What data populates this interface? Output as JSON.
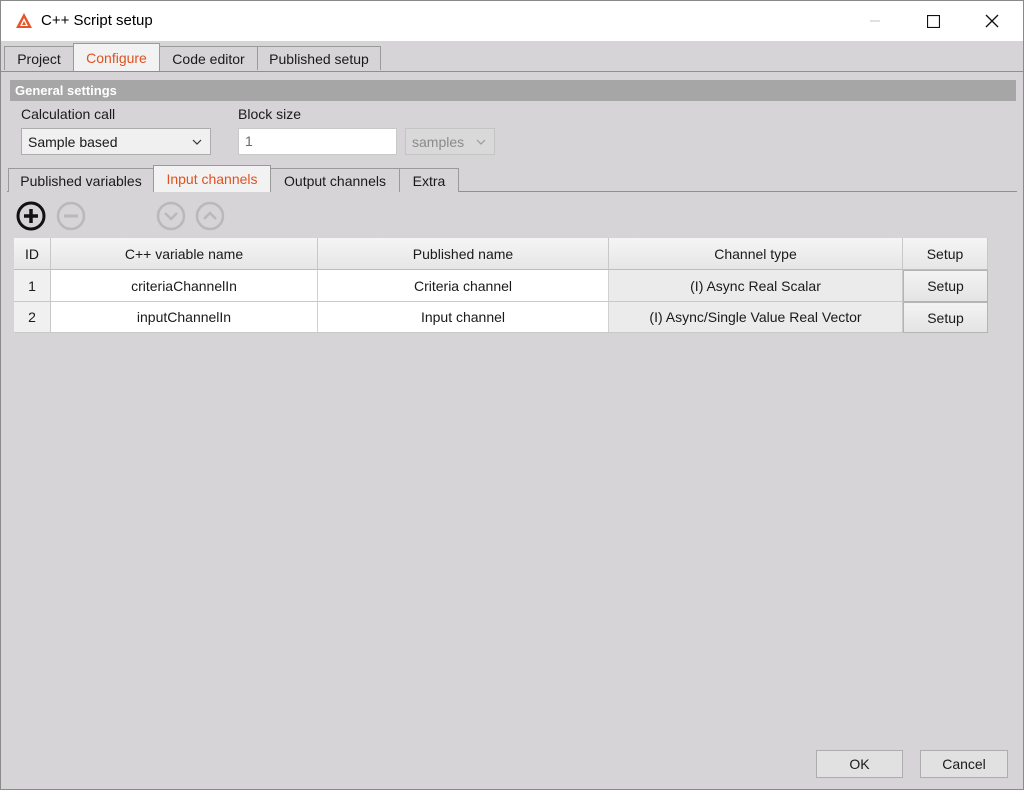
{
  "window": {
    "title": "C++ Script setup",
    "accent_color": "#e0521f"
  },
  "main_tabs": [
    {
      "label": "Project"
    },
    {
      "label": "Configure"
    },
    {
      "label": "Code editor"
    },
    {
      "label": "Published setup"
    }
  ],
  "general_settings": {
    "title": "General settings",
    "calc_label": "Calculation call",
    "calc_value": "Sample based",
    "block_label": "Block size",
    "block_value": "1",
    "block_unit": "samples"
  },
  "sub_tabs": [
    {
      "label": "Published variables"
    },
    {
      "label": "Input channels"
    },
    {
      "label": "Output channels"
    },
    {
      "label": "Extra"
    }
  ],
  "toolbar": {
    "icons": [
      "add-icon",
      "remove-icon",
      "move-down-icon",
      "move-up-icon"
    ]
  },
  "table": {
    "headers": [
      "ID",
      "C++ variable name",
      "Published name",
      "Channel type",
      "Setup"
    ],
    "rows": [
      {
        "id": "1",
        "var": "criteriaChannelIn",
        "pub": "Criteria channel",
        "type": "(I) Async Real Scalar",
        "setup": "Setup"
      },
      {
        "id": "2",
        "var": "inputChannelIn",
        "pub": "Input channel",
        "type": "(I) Async/Single Value Real Vector",
        "setup": "Setup"
      }
    ]
  },
  "footer": {
    "ok": "OK",
    "cancel": "Cancel"
  }
}
